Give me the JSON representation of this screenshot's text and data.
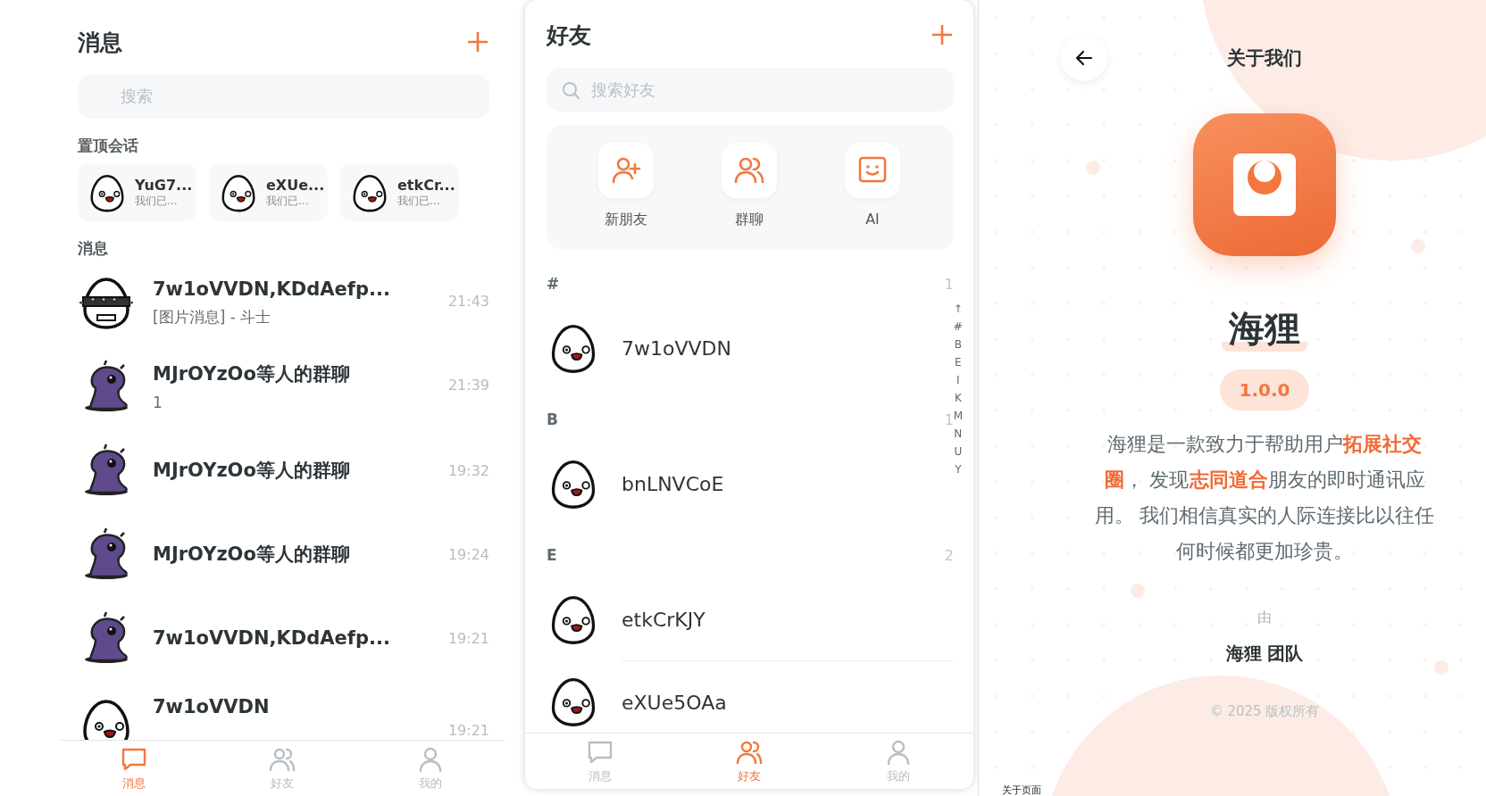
{
  "messages_screen": {
    "title": "消息",
    "search": {
      "placeholder": "搜索"
    },
    "pinned_heading": "置顶会话",
    "pinned": [
      {
        "name": "YuG7...",
        "preview": "我们已..."
      },
      {
        "name": "eXUe...",
        "preview": "我们已..."
      },
      {
        "name": "etkCr...",
        "preview": "我们已..."
      }
    ],
    "list_heading": "消息",
    "conversations": [
      {
        "kind": "spiked",
        "name": "7w1oVVDN,KDdAefp...",
        "preview": "[图片消息] - 斗士",
        "time": "21:43"
      },
      {
        "kind": "purple",
        "name": "MJrOYzOo等人的群聊",
        "preview": "1",
        "time": "21:39"
      },
      {
        "kind": "purple",
        "name": "MJrOYzOo等人的群聊",
        "time": "19:32"
      },
      {
        "kind": "purple",
        "name": "MJrOYzOo等人的群聊",
        "time": "19:24"
      },
      {
        "kind": "purple",
        "name": "7w1oVVDN,KDdAefp...",
        "time": "19:21"
      },
      {
        "kind": "egg",
        "name": "7w1oVVDN",
        "time": "19:21"
      }
    ],
    "tabs": [
      {
        "label": "消息",
        "selected": true
      },
      {
        "label": "好友",
        "selected": false
      },
      {
        "label": "我的",
        "selected": false
      }
    ]
  },
  "friends_screen": {
    "title": "好友",
    "search": {
      "placeholder": "搜索好友"
    },
    "actions": [
      {
        "kind": "add-friend",
        "label": "新朋友"
      },
      {
        "kind": "group",
        "label": "群聊"
      },
      {
        "kind": "ai",
        "label": "AI"
      }
    ],
    "sections": [
      {
        "letter": "#",
        "count": "1",
        "friends": [
          {
            "name": "7w1oVVDN"
          }
        ]
      },
      {
        "letter": "B",
        "count": "1",
        "friends": [
          {
            "name": "bnLNVCoE"
          }
        ]
      },
      {
        "letter": "E",
        "count": "2",
        "friends": [
          {
            "name": "etkCrKJY"
          },
          {
            "name": "eXUe5OAa"
          }
        ]
      }
    ],
    "index": [
      "↑",
      "#",
      "B",
      "E",
      "I",
      "K",
      "M",
      "N",
      "U",
      "Y"
    ],
    "tabs": [
      {
        "label": "消息",
        "selected": false
      },
      {
        "label": "好友",
        "selected": true
      },
      {
        "label": "我的",
        "selected": false
      }
    ]
  },
  "about_screen": {
    "title": "关于我们",
    "app_name": "海狸",
    "version": "1.0.0",
    "description": "海狸是一款致力于帮助用户**拓展社交圈**， 发现**志同道合**朋友的即时通讯应用。 我们相信真实的人际连接比以往任何时候都更加珍贵。",
    "by": "由",
    "team": "海狸 团队",
    "copyright": "© 2025 版权所有",
    "page_label": "关于页面"
  }
}
